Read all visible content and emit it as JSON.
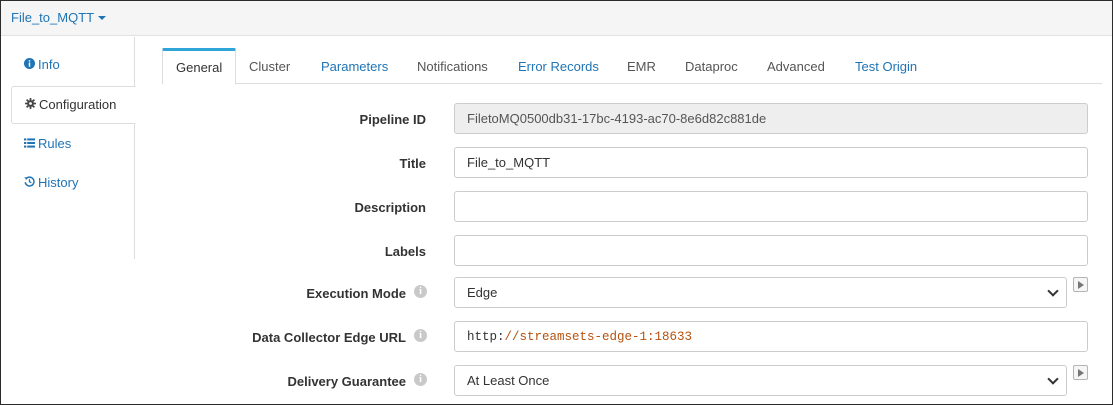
{
  "header": {
    "pipeline_name": "File_to_MQTT"
  },
  "sidebar": {
    "items": [
      {
        "label": "Info",
        "icon": "info-circle-icon"
      },
      {
        "label": "Configuration",
        "icon": "gear-icon",
        "active": true
      },
      {
        "label": "Rules",
        "icon": "list-icon"
      },
      {
        "label": "History",
        "icon": "history-icon"
      }
    ]
  },
  "tabs": [
    {
      "label": "General",
      "active": true
    },
    {
      "label": "Cluster"
    },
    {
      "label": "Parameters"
    },
    {
      "label": "Notifications"
    },
    {
      "label": "Error Records"
    },
    {
      "label": "EMR"
    },
    {
      "label": "Dataproc"
    },
    {
      "label": "Advanced"
    },
    {
      "label": "Test Origin"
    }
  ],
  "form": {
    "pipeline_id": {
      "label": "Pipeline ID",
      "value": "FiletoMQ0500db31-17bc-4193-ac70-8e6d82c881de"
    },
    "title": {
      "label": "Title",
      "value": "File_to_MQTT"
    },
    "description": {
      "label": "Description",
      "value": ""
    },
    "labels": {
      "label": "Labels",
      "value": ""
    },
    "execution_mode": {
      "label": "Execution Mode",
      "value": "Edge"
    },
    "edge_url": {
      "label": "Data Collector Edge URL",
      "protocol": "http:",
      "rest": "//streamsets-edge-1:18633"
    },
    "delivery_guarantee": {
      "label": "Delivery Guarantee",
      "value": "At Least Once"
    }
  },
  "colors": {
    "link": "#1f74b5",
    "active_tab_accent": "#2fa4d6",
    "url_text": "#b5520e"
  }
}
